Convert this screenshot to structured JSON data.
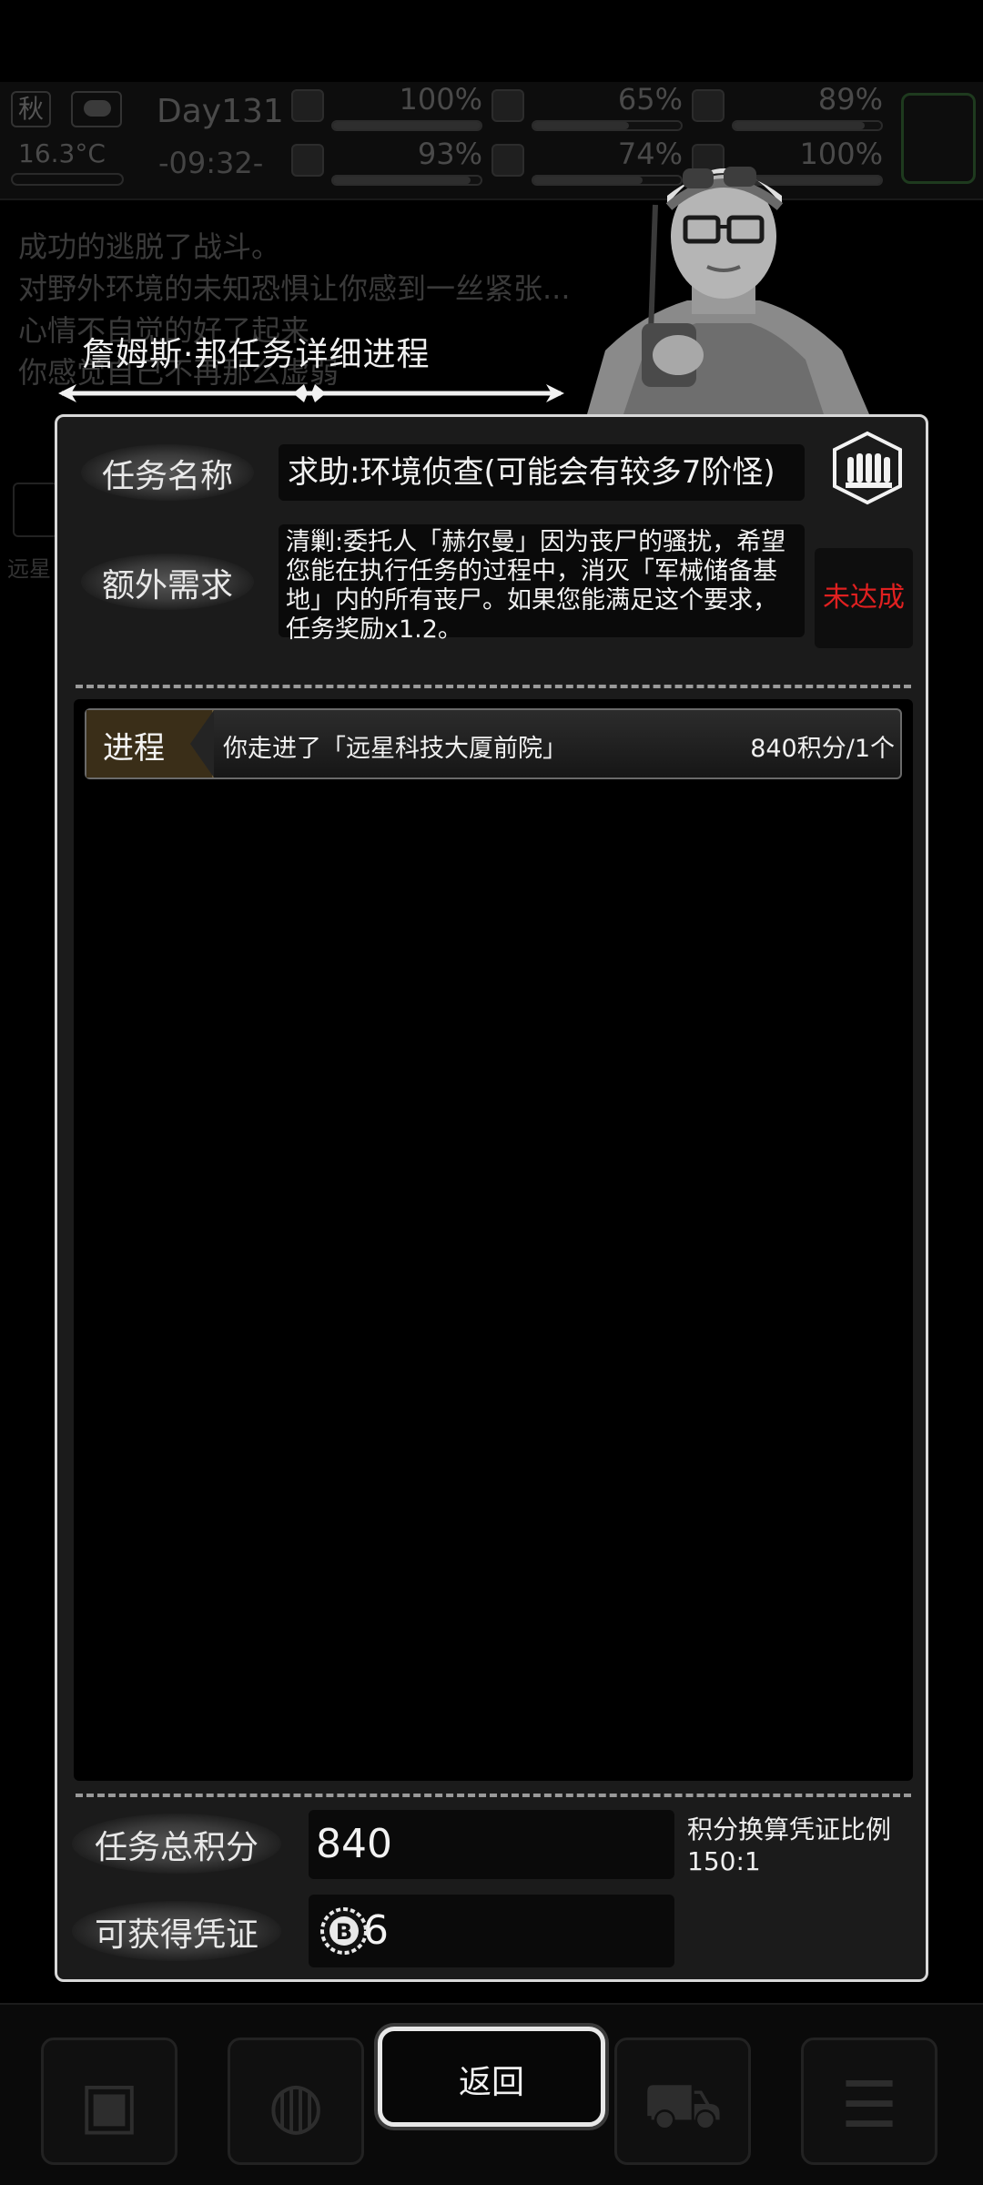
{
  "hud": {
    "season": "秋",
    "temperature": "16.3°C",
    "day": "Day131",
    "clock": "-09:32-",
    "stats": [
      {
        "icon": "medkit-icon",
        "percent": "100%",
        "value": 1.0
      },
      {
        "icon": "stomach-icon",
        "percent": "65%",
        "value": 0.65
      },
      {
        "icon": "mental-icon",
        "percent": "89%",
        "value": 0.89
      },
      {
        "icon": "boot-icon",
        "percent": "93%",
        "value": 0.93
      },
      {
        "icon": "water-drop-icon",
        "percent": "74%",
        "value": 0.74
      },
      {
        "icon": "stamina-icon",
        "percent": "100%",
        "value": 1.0
      }
    ]
  },
  "background_log": [
    "成功的逃脱了战斗。",
    "对野外环境的未知恐惧让你感到一丝紧张...",
    "心情不自觉的好了起来",
    "你感觉自己不再那么虚弱"
  ],
  "background_place": "远星",
  "dialog": {
    "title": "詹姆斯·邦任务详细进程",
    "task_name_label": "任务名称",
    "task_name": "求助:环境侦查(可能会有较多7阶怪)",
    "extra_label": "额外需求",
    "extra_text": "清剿:委托人「赫尔曼」因为丧尸的骚扰，希望您能在执行任务的过程中，消灭「军械储备基地」内的所有丧尸。如果您能满足这个要求，任务奖励x1.2。",
    "extra_status": "未达成",
    "progress": [
      {
        "tag": "进程",
        "text": "你走进了「远星科技大厦前院」",
        "score": "840积分/1个"
      }
    ],
    "total_label": "任务总积分",
    "total_value": "840",
    "ratio_label": "积分换算凭证比例",
    "ratio_value": "150:1",
    "voucher_label": "可获得凭证",
    "voucher_value": "6",
    "back_label": "返回"
  },
  "colors": {
    "status_red": "#e02020",
    "dialog_border": "#d8d8d8",
    "tag_brown": "#3a2e18"
  }
}
